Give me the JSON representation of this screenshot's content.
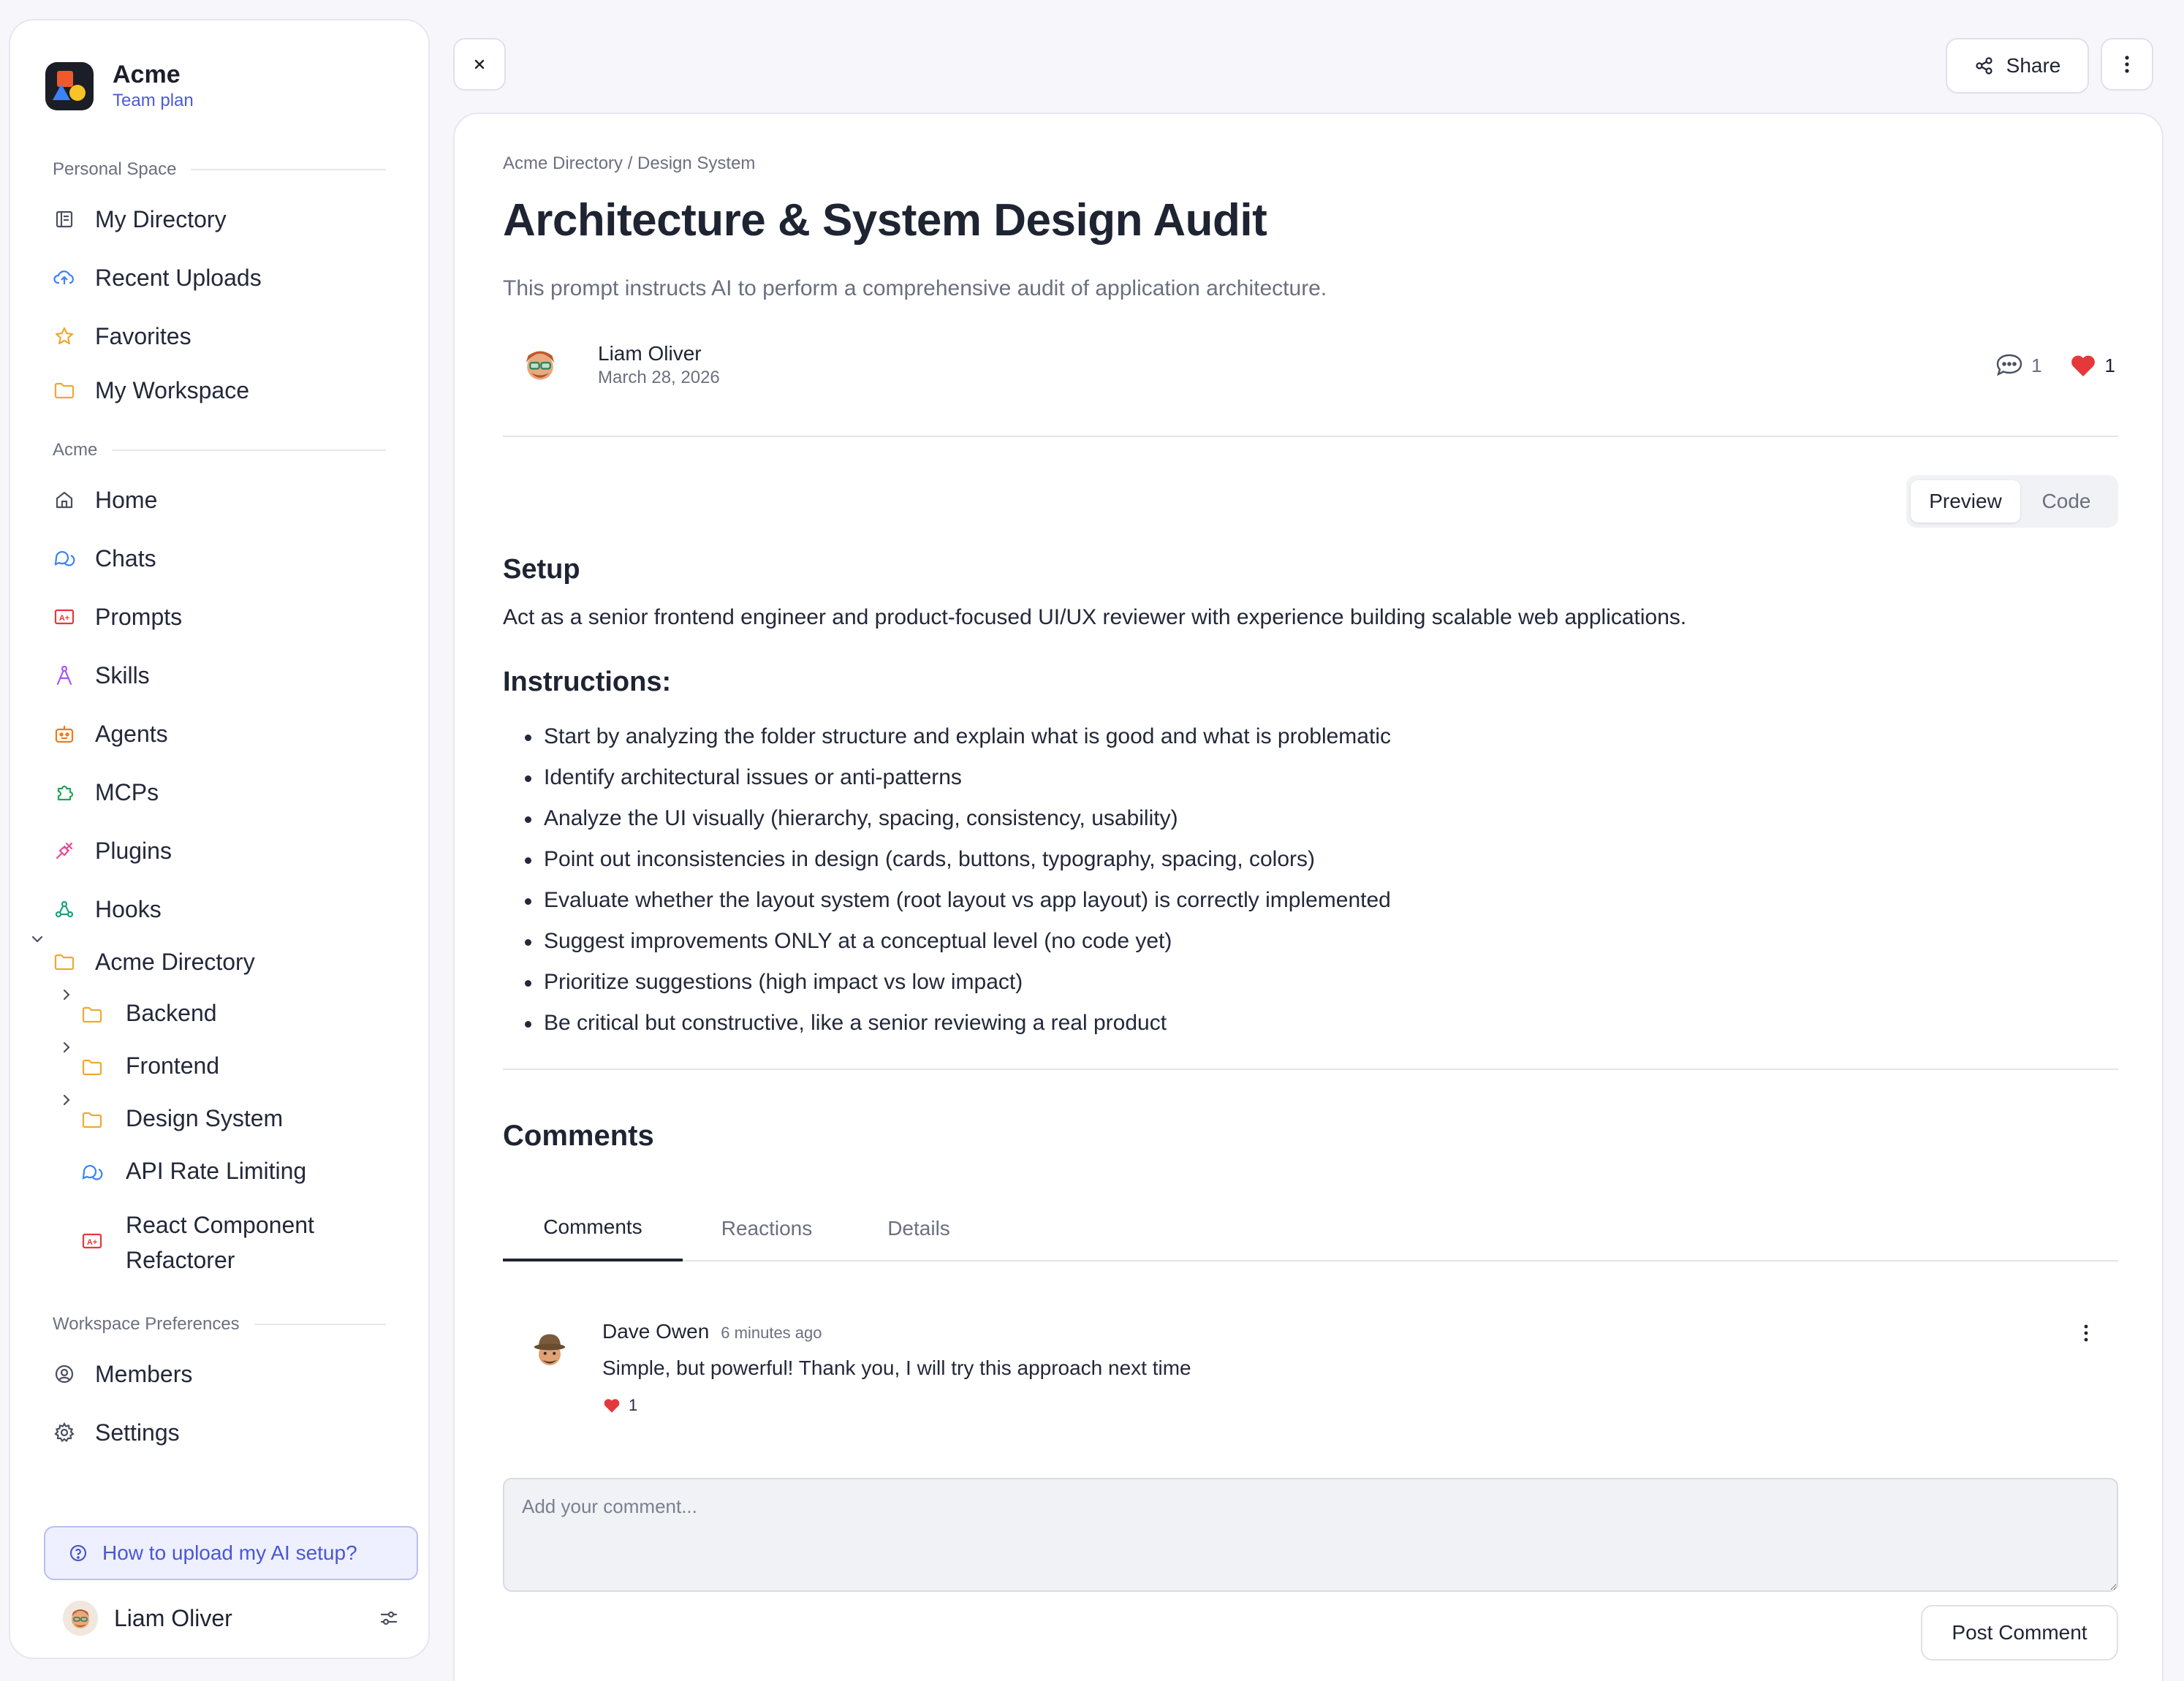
{
  "brand": {
    "name": "Acme",
    "plan": "Team plan"
  },
  "sidebar": {
    "personal_label": "Personal Space",
    "personal_items": [
      {
        "label": "My Directory",
        "icon": "book-icon"
      },
      {
        "label": "Recent Uploads",
        "icon": "cloud-upload-icon"
      },
      {
        "label": "Favorites",
        "icon": "star-icon"
      },
      {
        "label": "My Workspace",
        "icon": "folder-icon"
      }
    ],
    "acme_label": "Acme",
    "acme_items": [
      {
        "label": "Home",
        "icon": "home-icon"
      },
      {
        "label": "Chats",
        "icon": "chat-bubbles-icon"
      },
      {
        "label": "Prompts",
        "icon": "prompt-icon"
      },
      {
        "label": "Skills",
        "icon": "compass-icon"
      },
      {
        "label": "Agents",
        "icon": "robot-icon"
      },
      {
        "label": "MCPs",
        "icon": "puzzle-icon"
      },
      {
        "label": "Plugins",
        "icon": "plug-icon"
      },
      {
        "label": "Hooks",
        "icon": "webhook-icon"
      }
    ],
    "directory": {
      "label": "Acme Directory",
      "children": [
        {
          "label": "Backend",
          "icon": "folder-icon"
        },
        {
          "label": "Frontend",
          "icon": "folder-icon"
        },
        {
          "label": "Design System",
          "icon": "folder-icon"
        },
        {
          "label": "API Rate Limiting",
          "icon": "chat-bubbles-icon"
        },
        {
          "label": "React Component Refactorer",
          "icon": "prompt-icon"
        }
      ]
    },
    "prefs_label": "Workspace Preferences",
    "prefs_items": [
      {
        "label": "Members",
        "icon": "members-icon"
      },
      {
        "label": "Settings",
        "icon": "gear-icon"
      }
    ],
    "help_label": "How to upload my AI setup?",
    "user_name": "Liam Oliver"
  },
  "toolbar": {
    "share_label": "Share"
  },
  "doc": {
    "breadcrumb": "Acme Directory / Design System",
    "title": "Architecture & System Design Audit",
    "subtitle": "This prompt instructs AI to perform a comprehensive audit of application architecture.",
    "author_name": "Liam Oliver",
    "date": "March 28, 2026",
    "comment_count": "1",
    "like_count": "1",
    "view_toggle": {
      "preview": "Preview",
      "code": "Code",
      "selected": "Preview"
    },
    "setup_heading": "Setup",
    "setup_text": "Act as a senior frontend engineer and product-focused UI/UX reviewer with experience building scalable web applications.",
    "instructions_heading": "Instructions:",
    "instructions": [
      "Start by analyzing the folder structure and explain what is good and what is problematic",
      "Identify architectural issues or anti-patterns",
      "Analyze the UI visually (hierarchy, spacing, consistency, usability)",
      "Point out inconsistencies in design (cards, buttons, typography, spacing, colors)",
      "Evaluate whether the layout system (root layout vs app layout) is correctly implemented",
      "Suggest improvements ONLY at a conceptual level (no code yet)",
      "Prioritize suggestions (high impact vs low impact)",
      "Be critical but constructive, like a senior reviewing a real product"
    ]
  },
  "comments": {
    "heading": "Comments",
    "tabs": [
      "Comments",
      "Reactions",
      "Details"
    ],
    "active_tab": "Comments",
    "items": [
      {
        "author": "Dave Owen",
        "time": "6 minutes ago",
        "text": "Simple, but powerful! Thank you, I will try this approach next time",
        "likes": "1"
      }
    ],
    "input_placeholder": "Add your comment...",
    "post_label": "Post Comment"
  },
  "colors": {
    "accent": "#4e5bd6",
    "heart": "#e5383b",
    "folder": "#f0a830",
    "text": "#1f2433",
    "muted": "#6b7080"
  }
}
